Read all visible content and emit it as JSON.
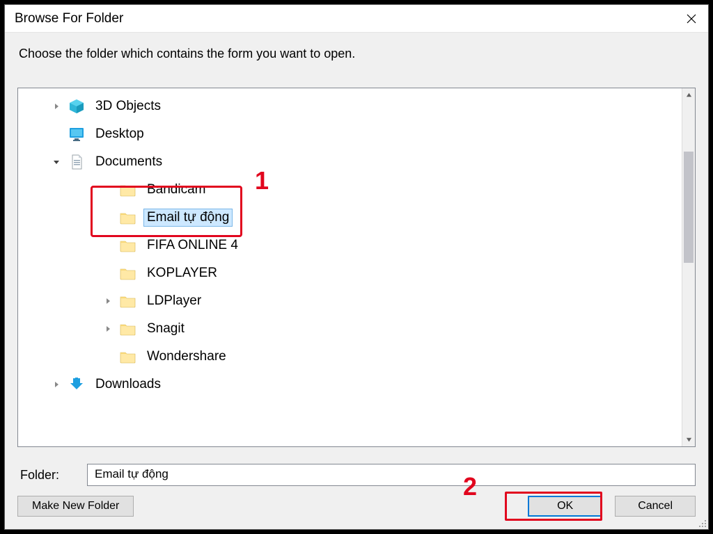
{
  "dialog": {
    "title": "Browse For Folder",
    "instruction": "Choose the folder which contains the form you want to open."
  },
  "tree": {
    "items": [
      {
        "label": "3D Objects",
        "icon": "cube3d",
        "expander": "closed",
        "depth": 0,
        "selected": false
      },
      {
        "label": "Desktop",
        "icon": "monitor",
        "expander": "none",
        "depth": 0,
        "selected": false
      },
      {
        "label": "Documents",
        "icon": "docfile",
        "expander": "open",
        "depth": 0,
        "selected": false
      },
      {
        "label": "Bandicam",
        "icon": "folder",
        "expander": "none",
        "depth": 1,
        "selected": false
      },
      {
        "label": "Email tự động",
        "icon": "folder",
        "expander": "none",
        "depth": 1,
        "selected": true
      },
      {
        "label": "FIFA ONLINE 4",
        "icon": "folder",
        "expander": "none",
        "depth": 1,
        "selected": false
      },
      {
        "label": "KOPLAYER",
        "icon": "folder",
        "expander": "none",
        "depth": 1,
        "selected": false
      },
      {
        "label": "LDPlayer",
        "icon": "folder",
        "expander": "closed",
        "depth": 1,
        "selected": false
      },
      {
        "label": "Snagit",
        "icon": "folder",
        "expander": "closed",
        "depth": 1,
        "selected": false
      },
      {
        "label": "Wondershare",
        "icon": "folder",
        "expander": "none",
        "depth": 1,
        "selected": false
      },
      {
        "label": "Downloads",
        "icon": "download",
        "expander": "closed",
        "depth": 0,
        "selected": false
      }
    ]
  },
  "folder": {
    "label": "Folder:",
    "value": "Email tự động"
  },
  "buttons": {
    "make_new": "Make New Folder",
    "ok": "OK",
    "cancel": "Cancel"
  },
  "annotations": {
    "one": "1",
    "two": "2"
  }
}
